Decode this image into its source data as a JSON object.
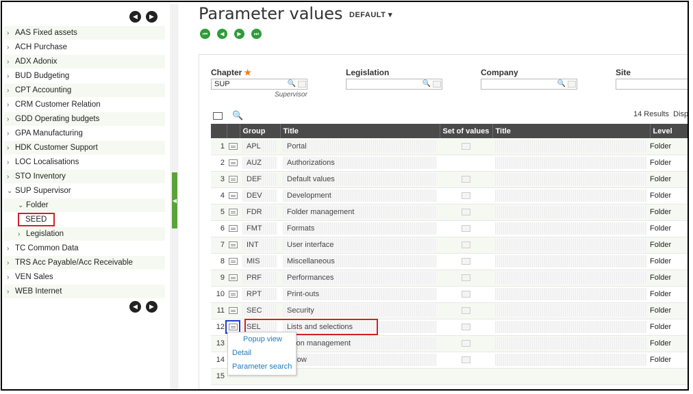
{
  "sidebar": {
    "items": [
      {
        "label": "AAS Fixed assets"
      },
      {
        "label": "ACH Purchase"
      },
      {
        "label": "ADX Adonix"
      },
      {
        "label": "BUD Budgeting"
      },
      {
        "label": "CPT Accounting"
      },
      {
        "label": "CRM Customer Relation"
      },
      {
        "label": "GDD Operating budgets"
      },
      {
        "label": "GPA Manufacturing"
      },
      {
        "label": "HDK Customer Support"
      },
      {
        "label": "LOC Localisations"
      },
      {
        "label": "STO Inventory"
      },
      {
        "label": "SUP Supervisor"
      },
      {
        "label": "Folder"
      },
      {
        "label": "SEED"
      },
      {
        "label": "Legislation"
      },
      {
        "label": "TC Common Data"
      },
      {
        "label": "TRS Acc Payable/Acc Receivable"
      },
      {
        "label": "VEN Sales"
      },
      {
        "label": "WEB Internet"
      }
    ]
  },
  "header": {
    "title": "Parameter values",
    "view_label": "DEFAULT"
  },
  "filters": {
    "chapter_label": "Chapter",
    "chapter_required": "★",
    "chapter_value": "SUP",
    "chapter_desc": "Supervisor",
    "legislation_label": "Legislation",
    "legislation_value": "",
    "company_label": "Company",
    "company_value": "",
    "site_label": "Site",
    "site_value": ""
  },
  "grid": {
    "results": "14 Results",
    "results_suffix": "Disp",
    "columns": [
      "",
      "",
      "Group",
      "Title",
      "Set of values",
      "Title",
      "Level"
    ],
    "rows": [
      {
        "n": "1",
        "group": "APL",
        "title": "Portal",
        "level": "Folder"
      },
      {
        "n": "2",
        "group": "AUZ",
        "title": "Authorizations",
        "level": "Folder"
      },
      {
        "n": "3",
        "group": "DEF",
        "title": "Default values",
        "level": "Folder"
      },
      {
        "n": "4",
        "group": "DEV",
        "title": "Development",
        "level": "Folder"
      },
      {
        "n": "5",
        "group": "FDR",
        "title": "Folder management",
        "level": "Folder"
      },
      {
        "n": "6",
        "group": "FMT",
        "title": "Formats",
        "level": "Folder"
      },
      {
        "n": "7",
        "group": "INT",
        "title": "User interface",
        "level": "Folder"
      },
      {
        "n": "8",
        "group": "MIS",
        "title": "Miscellaneous",
        "level": "Folder"
      },
      {
        "n": "9",
        "group": "PRF",
        "title": "Performances",
        "level": "Folder"
      },
      {
        "n": "10",
        "group": "RPT",
        "title": "Print-outs",
        "level": "Folder"
      },
      {
        "n": "11",
        "group": "SEC",
        "title": "Security",
        "level": "Folder"
      },
      {
        "n": "12",
        "group": "SEL",
        "title": "Lists and selections",
        "level": "Folder"
      },
      {
        "n": "13",
        "group": "",
        "title": "ession management",
        "level": "Folder"
      },
      {
        "n": "14",
        "group": "",
        "title": "orkflow",
        "level": "Folder"
      },
      {
        "n": "15",
        "group": "",
        "title": "",
        "level": ""
      }
    ]
  },
  "popup": {
    "items": [
      "Popup view",
      "Detail",
      "Parameter search"
    ]
  }
}
